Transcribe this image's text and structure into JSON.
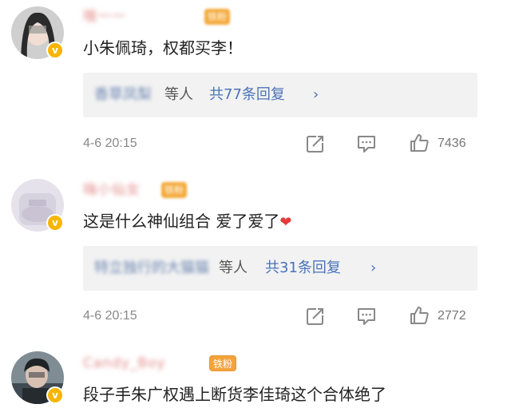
{
  "comments": [
    {
      "username": "哦一一",
      "fan_badge": "铁粉",
      "text": "小朱佩琦，权都买李！",
      "reply_names": "香草凤梨",
      "reply_etc": "等人",
      "reply_count": "共77条回复",
      "reply_chevron": "›",
      "timestamp": "4-6 20:15",
      "likes": "7436"
    },
    {
      "username": "嗨小仙女",
      "fan_badge": "铁粉",
      "text": "这是什么神仙组合 爱了爱了",
      "heart": "❤",
      "reply_names": "特立独行的大猫猫",
      "reply_etc": "等人",
      "reply_count": "共31条回复",
      "reply_chevron": "›",
      "timestamp": "4-6 20:15",
      "likes": "2772"
    },
    {
      "username": "Candy_Boy",
      "fan_badge": "铁粉",
      "text": "段子手朱广权遇上断货李佳琦这个合体绝了"
    }
  ],
  "verified_badge": "v",
  "colors": {
    "reply_link": "#4a73b8",
    "verified": "#f7b500",
    "heart": "#e33a3a"
  }
}
